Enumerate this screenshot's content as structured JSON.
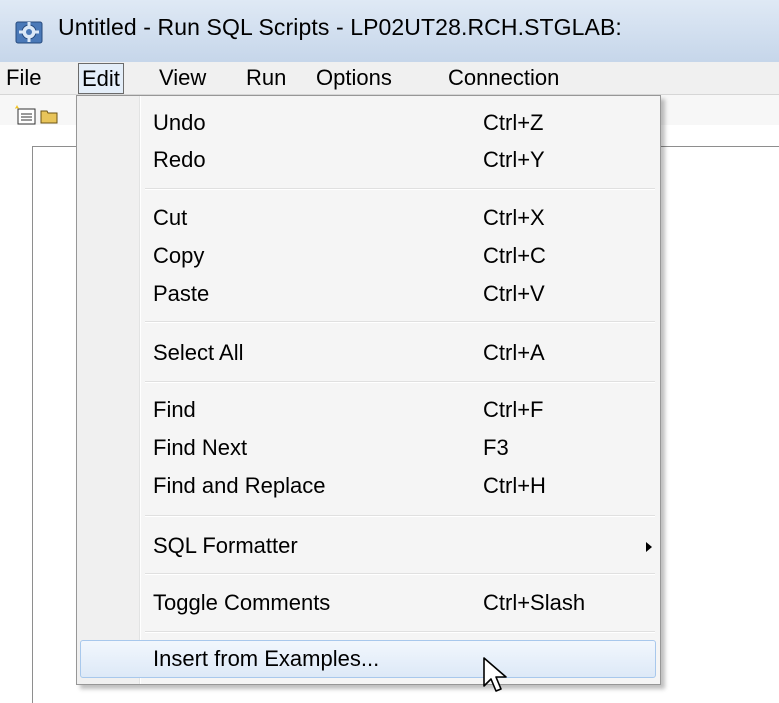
{
  "window": {
    "title": "Untitled - Run SQL Scripts - LP02UT28.RCH.STGLAB:"
  },
  "menubar": {
    "items": [
      {
        "label": "File"
      },
      {
        "label": "Edit"
      },
      {
        "label": "View"
      },
      {
        "label": "Run"
      },
      {
        "label": "Options"
      },
      {
        "label": "Connection"
      }
    ],
    "open_menu": "Edit"
  },
  "edit_menu": {
    "items": [
      {
        "label": "Undo",
        "shortcut": "Ctrl+Z"
      },
      {
        "label": "Redo",
        "shortcut": "Ctrl+Y"
      },
      {
        "label": "Cut",
        "shortcut": "Ctrl+X"
      },
      {
        "label": "Copy",
        "shortcut": "Ctrl+C"
      },
      {
        "label": "Paste",
        "shortcut": "Ctrl+V"
      },
      {
        "label": "Select All",
        "shortcut": "Ctrl+A"
      },
      {
        "label": "Find",
        "shortcut": "Ctrl+F"
      },
      {
        "label": "Find Next",
        "shortcut": "F3"
      },
      {
        "label": "Find and Replace",
        "shortcut": "Ctrl+H"
      },
      {
        "label": "SQL Formatter",
        "shortcut": ""
      },
      {
        "label": "Toggle Comments",
        "shortcut": "Ctrl+Slash"
      },
      {
        "label": "Insert from Examples...",
        "shortcut": ""
      }
    ],
    "highlighted_item": "Insert from Examples...",
    "submenu_item": "SQL Formatter"
  },
  "icons": {
    "app": "database-gear-icon",
    "toolbar_new": "new-script-icon",
    "toolbar_open": "open-folder-icon",
    "submenu": "chevron-right-icon",
    "cursor": "mouse-pointer-icon"
  },
  "colors": {
    "titlebar": "#c6d6ea",
    "menu_background": "#f5f5f5",
    "highlight_border": "#a8c8ec",
    "highlight_fill": "#dde9f7"
  }
}
